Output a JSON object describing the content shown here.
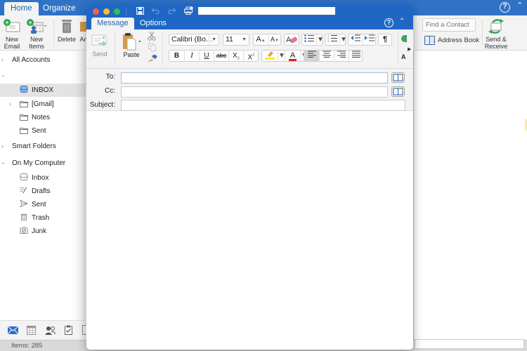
{
  "main_window": {
    "tabs": [
      {
        "label": "Home",
        "active": true
      },
      {
        "label": "Organize",
        "active": false
      }
    ],
    "ribbon": {
      "new_email": "New\nEmail",
      "new_email_l1": "New",
      "new_email_l2": "Email",
      "new_items_l1": "New",
      "new_items_l2": "Items",
      "delete": "Delete",
      "archive_partial": "Ar",
      "find_contact_placeholder": "Find a Contact",
      "address_book": "Address Book",
      "send_receive_l1": "Send &",
      "send_receive_l2": "Receive"
    },
    "help_icon": "?",
    "collapse_icon": "^"
  },
  "sidebar": {
    "items": [
      {
        "label": "All Accounts",
        "chevron": "right",
        "level": 0
      },
      {
        "label": "",
        "chevron": "down",
        "level": 0
      },
      {
        "label": "INBOX",
        "icon": "inbox-icon",
        "level": 1,
        "selected": true
      },
      {
        "label": "[Gmail]",
        "icon": "folder-icon",
        "chevron": "right",
        "level": 1
      },
      {
        "label": "Notes",
        "icon": "folder-icon",
        "level": 1
      },
      {
        "label": "Sent",
        "icon": "folder-icon",
        "level": 1
      },
      {
        "label": "Smart Folders",
        "chevron": "right",
        "level": 0
      },
      {
        "label": "On My Computer",
        "chevron": "down",
        "level": 0
      },
      {
        "label": "Inbox",
        "icon": "inbox-icon",
        "level": 1
      },
      {
        "label": "Drafts",
        "icon": "drafts-icon",
        "level": 1
      },
      {
        "label": "Sent",
        "icon": "sent-icon",
        "level": 1
      },
      {
        "label": "Trash",
        "icon": "trash-icon",
        "level": 1
      },
      {
        "label": "Junk",
        "icon": "junk-icon",
        "level": 1
      }
    ]
  },
  "bottom_nav": [
    "mail-icon",
    "calendar-icon",
    "people-icon",
    "tasks-icon"
  ],
  "status": {
    "items_text": "Items: 285"
  },
  "compose": {
    "title_value": "",
    "tabs": [
      {
        "label": "Message",
        "active": true
      },
      {
        "label": "Options",
        "active": false
      }
    ],
    "ribbon": {
      "send": "Send",
      "paste": "Paste",
      "font_name": "Calibri (Bo...",
      "font_size": "11",
      "bold": "B",
      "italic": "I",
      "underline": "U",
      "strikethrough": "abc",
      "subscript": "X",
      "superscript": "X",
      "grow_font": "A",
      "shrink_font": "A",
      "font_color": "A",
      "pilcrow": "¶",
      "overflow_partial": "A"
    },
    "colors": {
      "highlight": "#f5ef2a",
      "font_color": "#e31b1b",
      "title_bar": "#2067c5",
      "main_bar": "#2f72c6"
    },
    "fields": {
      "to_label": "To:",
      "to_value": "",
      "cc_label": "Cc:",
      "cc_value": "",
      "subject_label": "Subject:",
      "subject_value": ""
    },
    "body": ""
  }
}
